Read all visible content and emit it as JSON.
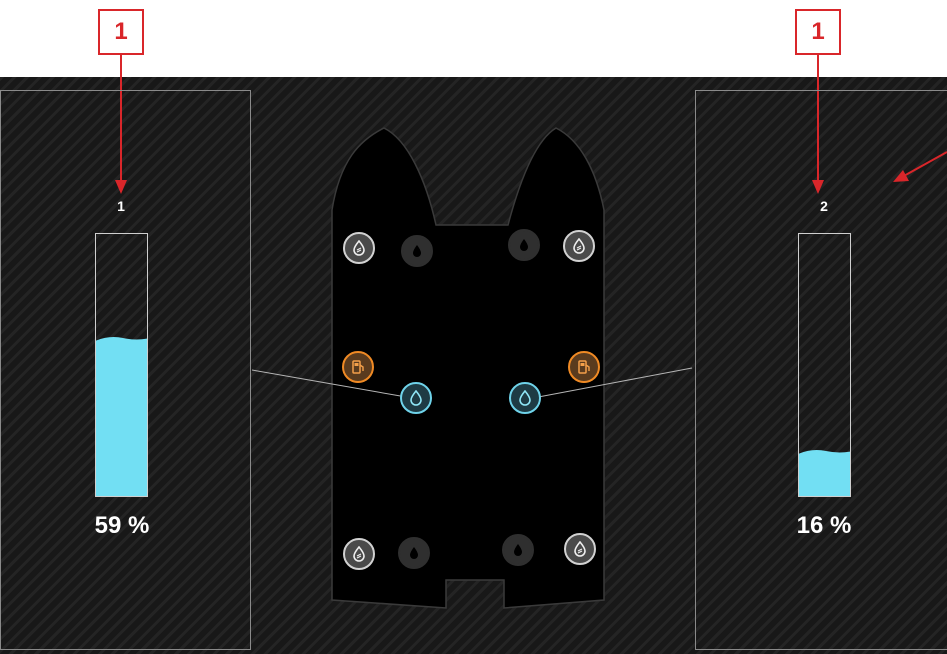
{
  "annotations": {
    "callout_left": "1",
    "callout_right": "1"
  },
  "tanks": [
    {
      "id": "1",
      "level_percent": 59,
      "label": "59 %"
    },
    {
      "id": "2",
      "level_percent": 16,
      "label": "16 %"
    }
  ],
  "colors": {
    "annotation": "#d9262a",
    "water": "#72dff3",
    "fuel": "#f08a24",
    "inactive": "#d2d2d2"
  },
  "boat_nodes": [
    {
      "name": "water-drop-icon",
      "type": "grey-tank"
    },
    {
      "name": "water-drop-icon",
      "type": "inactive"
    },
    {
      "name": "water-drop-icon",
      "type": "inactive"
    },
    {
      "name": "water-drop-icon",
      "type": "grey-tank"
    },
    {
      "name": "fuel-pump-icon",
      "type": "fuel"
    },
    {
      "name": "water-drop-icon",
      "type": "water-selected"
    },
    {
      "name": "water-drop-icon",
      "type": "water-selected"
    },
    {
      "name": "fuel-pump-icon",
      "type": "fuel"
    },
    {
      "name": "water-drop-icon",
      "type": "grey-tank"
    },
    {
      "name": "water-drop-icon",
      "type": "inactive"
    },
    {
      "name": "water-drop-icon",
      "type": "inactive"
    },
    {
      "name": "water-drop-icon",
      "type": "grey-tank"
    }
  ]
}
